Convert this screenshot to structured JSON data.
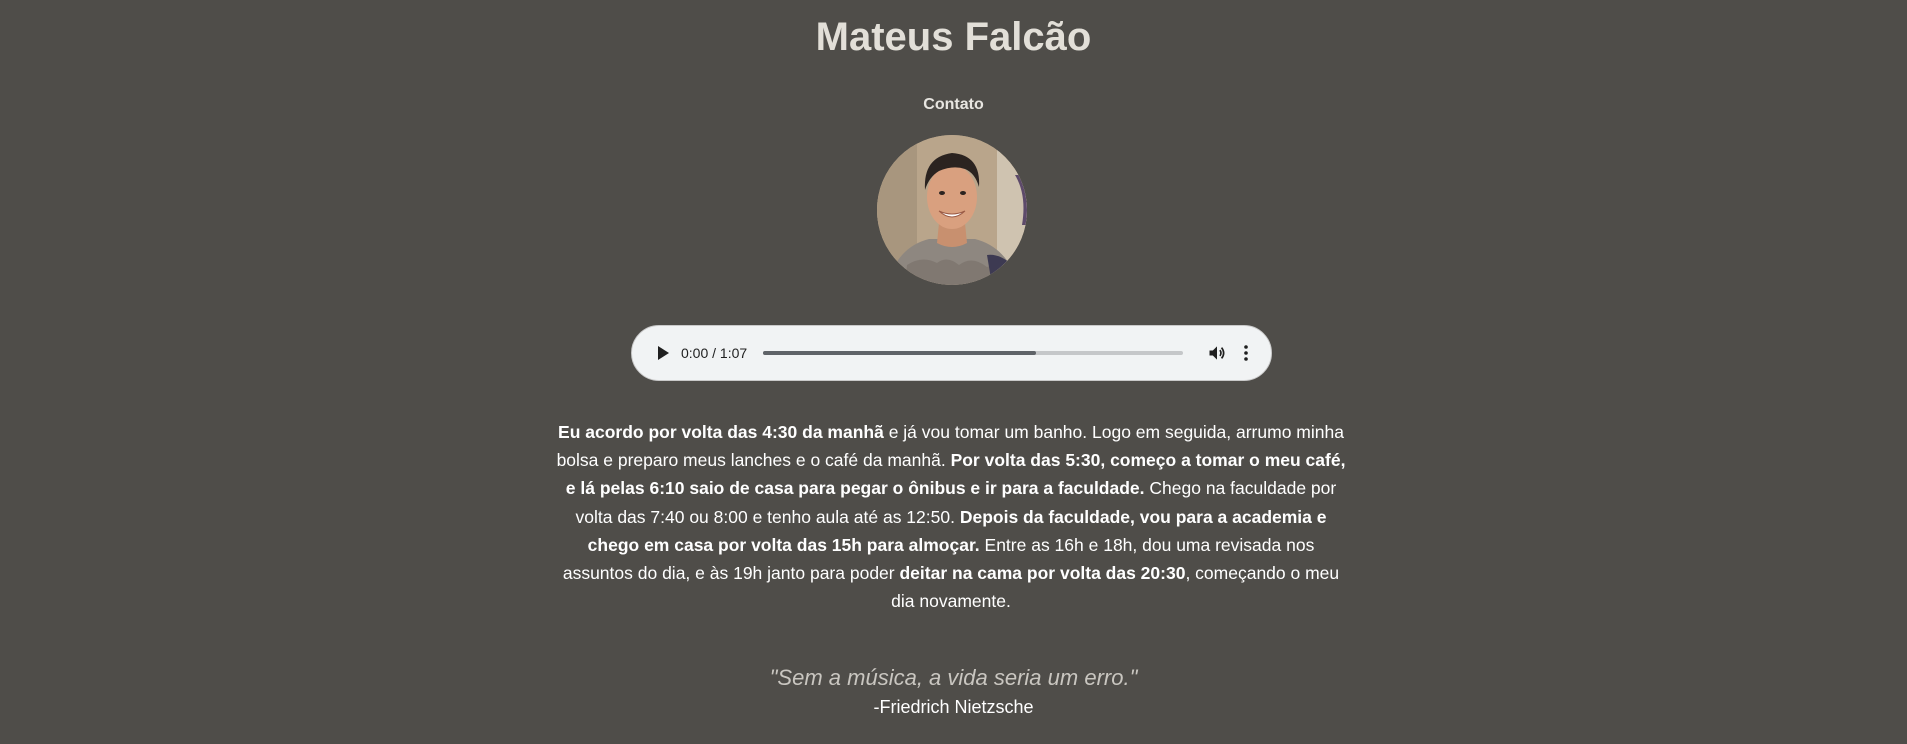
{
  "header": {
    "title": "Mateus Falcão",
    "contact_label": "Contato"
  },
  "profile": {
    "avatar_alt": "Mateus Falcão"
  },
  "audio_player": {
    "time_display": "0:00 / 1:07",
    "buffered_fraction": 0.65,
    "play_icon": "play-icon",
    "volume_icon": "volume-icon",
    "more_icon": "more-vert-icon"
  },
  "bio": {
    "segments": [
      {
        "text": "Eu acordo por volta das 4:30 da manhã",
        "bold": true
      },
      {
        "text": " e já vou tomar um banho. Logo em seguida, arrumo minha bolsa e preparo meus lanches e o café da manhã. ",
        "bold": false
      },
      {
        "text": "Por volta das 5:30, começo a tomar o meu café, e lá pelas 6:10 saio de casa para pegar o ônibus e ir para a faculdade.",
        "bold": true
      },
      {
        "text": " Chego na faculdade por volta das 7:40 ou 8:00 e tenho aula até as 12:50. ",
        "bold": false
      },
      {
        "text": "Depois da faculdade, vou para a academia e chego em casa por volta das 15h para almoçar.",
        "bold": true
      },
      {
        "text": " Entre as 16h e 18h, dou uma revisada nos assuntos do dia, e às 19h janto para poder ",
        "bold": false
      },
      {
        "text": "deitar na cama por volta das 20:30",
        "bold": true
      },
      {
        "text": ", começando o meu dia novamente.",
        "bold": false
      }
    ]
  },
  "quote": {
    "text": "\"Sem a música, a vida seria um erro.\"",
    "author": "-Friedrich Nietzsche"
  },
  "colors": {
    "background": "#4f4d49",
    "title": "#e2dfd8",
    "quote": "#c9c6c0",
    "player_bg": "#f1f3f4"
  }
}
